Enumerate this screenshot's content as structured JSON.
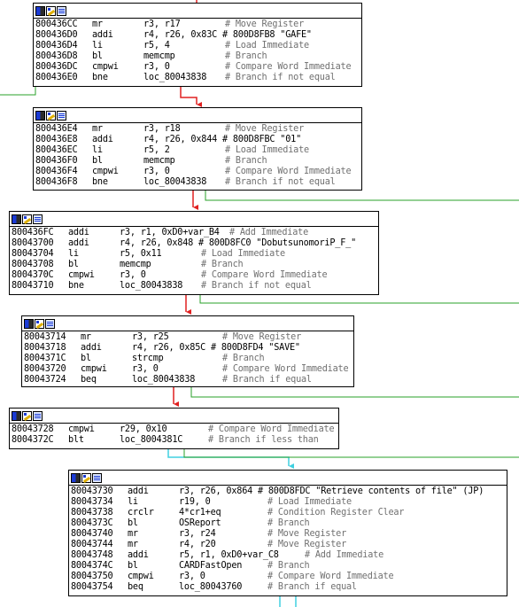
{
  "colors": {
    "edge_false": "#2aa02a",
    "edge_true": "#e02020",
    "edge_uncond": "#40d0e0"
  },
  "blocks": [
    {
      "lines": [
        {
          "addr": "800436CC",
          "mnem": "mr",
          "ops": "r3, r17",
          "cmt": "# Move Register"
        },
        {
          "addr": "800436D0",
          "mnem": "addi",
          "ops": "r4, r26, 0x83C # 800D8FB8 \"GAFE\"",
          "cmt": ""
        },
        {
          "addr": "800436D4",
          "mnem": "li",
          "ops": "r5, 4",
          "cmt": "# Load Immediate"
        },
        {
          "addr": "800436D8",
          "mnem": "bl",
          "ops": "memcmp",
          "cmt": "# Branch"
        },
        {
          "addr": "800436DC",
          "mnem": "cmpwi",
          "ops": "r3, 0",
          "cmt": "# Compare Word Immediate"
        },
        {
          "addr": "800436E0",
          "mnem": "bne",
          "ops": "loc_80043838",
          "cmt": "# Branch if not equal"
        }
      ]
    },
    {
      "lines": [
        {
          "addr": "800436E4",
          "mnem": "mr",
          "ops": "r3, r18",
          "cmt": "# Move Register"
        },
        {
          "addr": "800436E8",
          "mnem": "addi",
          "ops": "r4, r26, 0x844 # 800D8FBC \"01\"",
          "cmt": ""
        },
        {
          "addr": "800436EC",
          "mnem": "li",
          "ops": "r5, 2",
          "cmt": "# Load Immediate"
        },
        {
          "addr": "800436F0",
          "mnem": "bl",
          "ops": "memcmp",
          "cmt": "# Branch"
        },
        {
          "addr": "800436F4",
          "mnem": "cmpwi",
          "ops": "r3, 0",
          "cmt": "# Compare Word Immediate"
        },
        {
          "addr": "800436F8",
          "mnem": "bne",
          "ops": "loc_80043838",
          "cmt": "# Branch if not equal"
        }
      ]
    },
    {
      "lines": [
        {
          "addr": "800436FC",
          "mnem": "addi",
          "ops": "r3, r1, 0xD0+var_B4",
          "cmt": "# Add Immediate"
        },
        {
          "addr": "80043700",
          "mnem": "addi",
          "ops": "r4, r26, 0x848 # 800D8FC0 \"DobutsunomoriP_F_\"",
          "cmt": ""
        },
        {
          "addr": "80043704",
          "mnem": "li",
          "ops": "r5, 0x11",
          "cmt": "# Load Immediate"
        },
        {
          "addr": "80043708",
          "mnem": "bl",
          "ops": "memcmp",
          "cmt": "# Branch"
        },
        {
          "addr": "8004370C",
          "mnem": "cmpwi",
          "ops": "r3, 0",
          "cmt": "# Compare Word Immediate"
        },
        {
          "addr": "80043710",
          "mnem": "bne",
          "ops": "loc_80043838",
          "cmt": "# Branch if not equal"
        }
      ]
    },
    {
      "lines": [
        {
          "addr": "80043714",
          "mnem": "mr",
          "ops": "r3, r25",
          "cmt": "# Move Register"
        },
        {
          "addr": "80043718",
          "mnem": "addi",
          "ops": "r4, r26, 0x85C # 800D8FD4 \"SAVE\"",
          "cmt": ""
        },
        {
          "addr": "8004371C",
          "mnem": "bl",
          "ops": "strcmp",
          "cmt": "# Branch"
        },
        {
          "addr": "80043720",
          "mnem": "cmpwi",
          "ops": "r3, 0",
          "cmt": "# Compare Word Immediate"
        },
        {
          "addr": "80043724",
          "mnem": "beq",
          "ops": "loc_80043838",
          "cmt": "# Branch if equal"
        }
      ]
    },
    {
      "lines": [
        {
          "addr": "80043728",
          "mnem": "cmpwi",
          "ops": "r29, 0x10",
          "cmt": "# Compare Word Immediate"
        },
        {
          "addr": "8004372C",
          "mnem": "blt",
          "ops": "loc_8004381C",
          "cmt": "# Branch if less than"
        }
      ]
    },
    {
      "lines": [
        {
          "addr": "80043730",
          "mnem": "addi",
          "ops": "r3, r26, 0x864 # 800D8FDC \"Retrieve contents of file\" (JP)",
          "cmt": ""
        },
        {
          "addr": "80043734",
          "mnem": "li",
          "ops": "r19, 0",
          "cmt": "# Load Immediate"
        },
        {
          "addr": "80043738",
          "mnem": "crclr",
          "ops": "4*cr1+eq",
          "cmt": "# Condition Register Clear"
        },
        {
          "addr": "8004373C",
          "mnem": "bl",
          "ops": "OSReport",
          "cmt": "# Branch"
        },
        {
          "addr": "80043740",
          "mnem": "mr",
          "ops": "r3, r24",
          "cmt": "# Move Register"
        },
        {
          "addr": "80043744",
          "mnem": "mr",
          "ops": "r4, r20",
          "cmt": "# Move Register"
        },
        {
          "addr": "80043748",
          "mnem": "addi",
          "ops": "r5, r1, 0xD0+var_C8",
          "cmt": "# Add Immediate"
        },
        {
          "addr": "8004374C",
          "mnem": "bl",
          "ops": "CARDFastOpen",
          "cmt": "# Branch"
        },
        {
          "addr": "80043750",
          "mnem": "cmpwi",
          "ops": "r3, 0",
          "cmt": "# Compare Word Immediate"
        },
        {
          "addr": "80043754",
          "mnem": "beq",
          "ops": "loc_80043760",
          "cmt": "# Branch if equal"
        }
      ]
    }
  ]
}
